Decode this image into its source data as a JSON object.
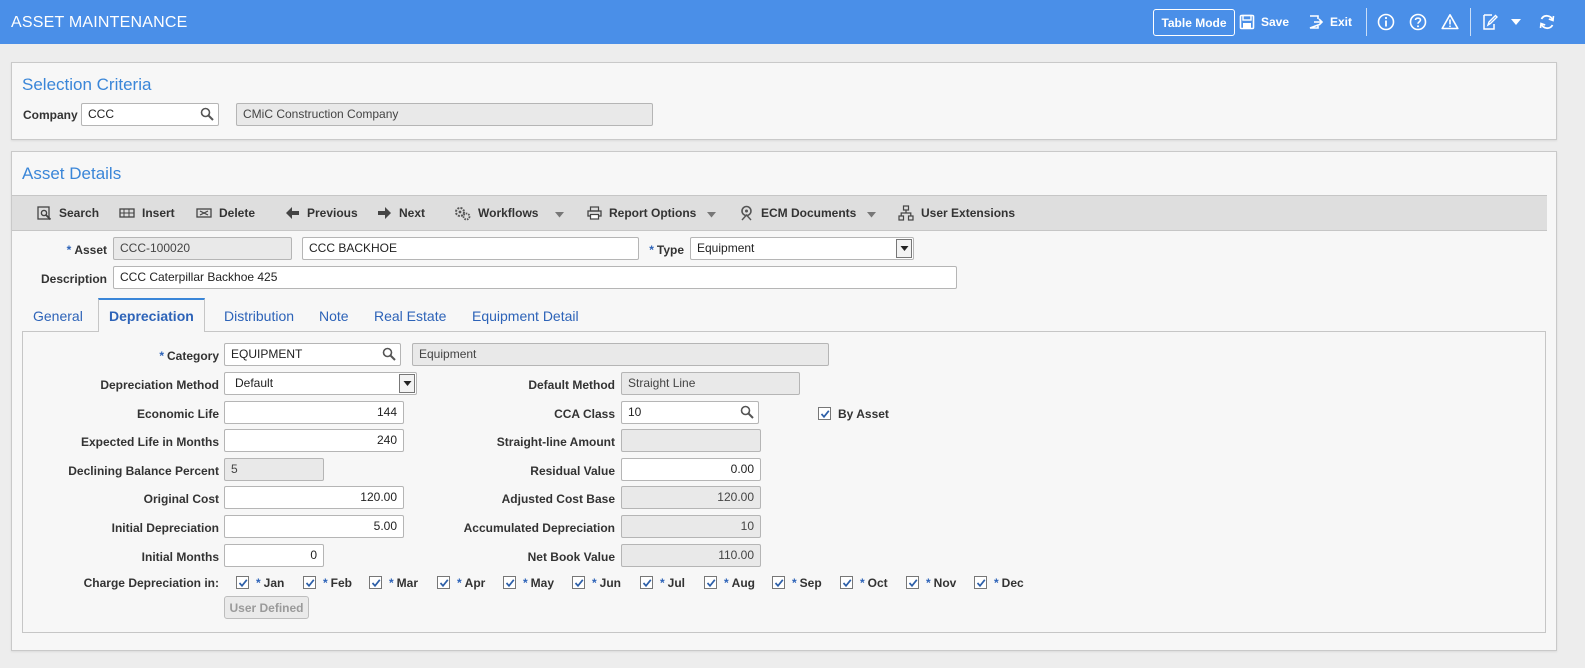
{
  "app": {
    "title": "ASSET MAINTENANCE"
  },
  "topbar": {
    "table_mode": "Table Mode",
    "save": "Save",
    "exit": "Exit",
    "icons": [
      "info-icon",
      "help-icon",
      "warning-icon",
      "edit-icon",
      "chevron-down-icon",
      "refresh-icon"
    ]
  },
  "selection": {
    "title": "Selection Criteria",
    "company_label": "Company",
    "company_value": "CCC",
    "company_name": "CMiC Construction Company"
  },
  "asset_details": {
    "title": "Asset Details",
    "toolbar": {
      "search": "Search",
      "insert": "Insert",
      "delete": "Delete",
      "previous": "Previous",
      "next": "Next",
      "workflows": "Workflows",
      "report_options": "Report Options",
      "ecm_documents": "ECM Documents",
      "user_extensions": "User Extensions"
    },
    "asset_label": "Asset",
    "asset_code": "CCC-100020",
    "asset_name": "CCC BACKHOE",
    "type_label": "Type",
    "type_value": "Equipment",
    "description_label": "Description",
    "description_value": "CCC Caterpillar Backhoe 425"
  },
  "tabs": [
    {
      "label": "General"
    },
    {
      "label": "Depreciation"
    },
    {
      "label": "Distribution"
    },
    {
      "label": "Note"
    },
    {
      "label": "Real Estate"
    },
    {
      "label": "Equipment Detail"
    }
  ],
  "depreciation": {
    "category_label": "Category",
    "category_value": "EQUIPMENT",
    "category_desc": "Equipment",
    "method_label": "Depreciation Method",
    "method_value": "Default",
    "default_method_label": "Default Method",
    "default_method_value": "Straight Line",
    "economic_life_label": "Economic Life",
    "economic_life_value": "144",
    "cca_class_label": "CCA Class",
    "cca_class_value": "10",
    "by_asset_label": "By Asset",
    "expected_life_label": "Expected Life in Months",
    "expected_life_value": "240",
    "straight_line_label": "Straight-line Amount",
    "straight_line_value": "",
    "declining_label": "Declining Balance Percent",
    "declining_value": "5",
    "residual_label": "Residual Value",
    "residual_value": "0.00",
    "original_cost_label": "Original Cost",
    "original_cost_value": "120.00",
    "adjusted_cost_label": "Adjusted Cost Base",
    "adjusted_cost_value": "120.00",
    "initial_dep_label": "Initial Depreciation",
    "initial_dep_value": "5.00",
    "accumulated_label": "Accumulated Depreciation",
    "accumulated_value": "10",
    "initial_months_label": "Initial Months",
    "initial_months_value": "0",
    "net_book_label": "Net Book Value",
    "net_book_value": "110.00",
    "charge_label": "Charge Depreciation in:",
    "months": [
      "Jan",
      "Feb",
      "Mar",
      "Apr",
      "May",
      "Jun",
      "Jul",
      "Aug",
      "Sep",
      "Oct",
      "Nov",
      "Dec"
    ],
    "user_defined": "User Defined"
  }
}
